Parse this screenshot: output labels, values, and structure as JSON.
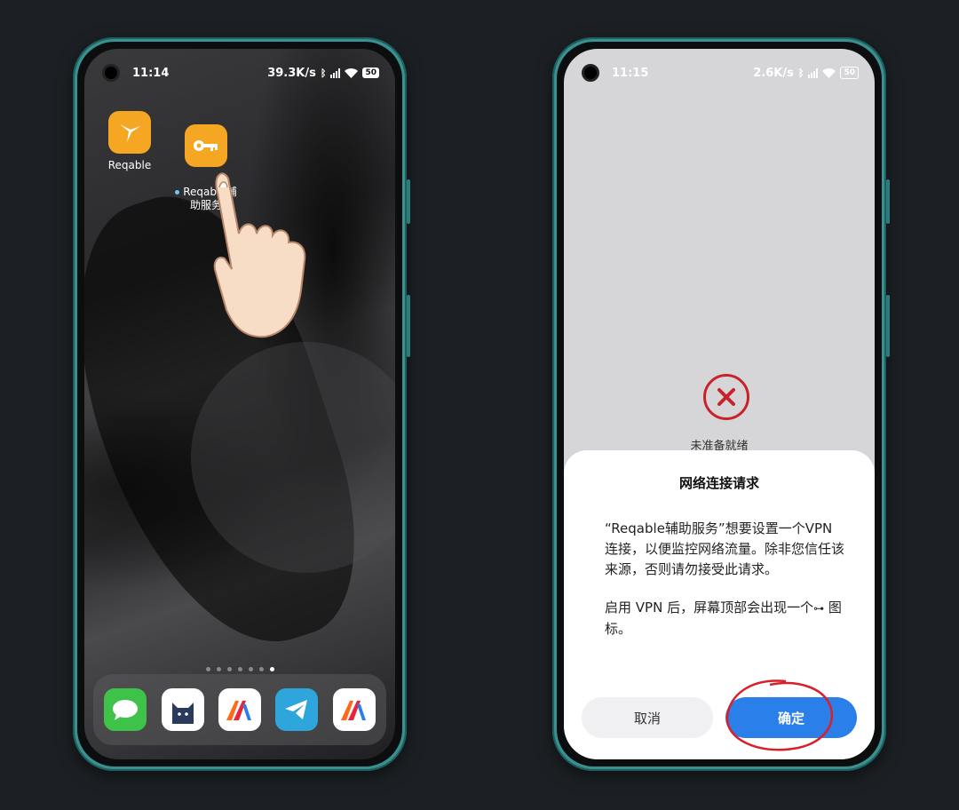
{
  "left_phone": {
    "status": {
      "time": "11:14",
      "net_speed": "39.3K/s",
      "battery": "50"
    },
    "apps": [
      {
        "label": "Reqable",
        "icon": "hummingbird-icon",
        "has_dot": false
      },
      {
        "label": "Reqable辅\n助服务",
        "icon": "key-icon",
        "has_dot": true
      }
    ],
    "pager_count": 7,
    "pager_active": 6,
    "dock": [
      "messages-icon",
      "cat-app-icon",
      "reqable-red-icon",
      "telegram-icon",
      "reqable-red-icon"
    ]
  },
  "right_phone": {
    "status": {
      "time": "11:15",
      "net_speed": "2.6K/s",
      "battery": "50"
    },
    "not_ready_label": "未准备就绪",
    "dialog": {
      "title": "网络连接请求",
      "body_1": "“Reqable辅助服务”想要设置一个VPN 连接，以便监控网络流量。除非您信任该来源，否则请勿接受此请求。",
      "body_2_prefix": "启用 VPN 后，屏幕顶部会出现一个",
      "body_2_suffix": " 图标。",
      "cancel_label": "取消",
      "confirm_label": "确定"
    }
  },
  "colors": {
    "accent": "#2b7fe8",
    "app_orange": "#f5a623",
    "error_red": "#c8232b",
    "frame": "#3a8f8f"
  }
}
